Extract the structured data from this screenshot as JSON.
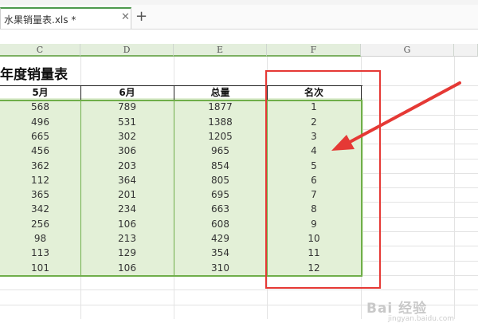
{
  "tabs": {
    "file_name": "水果销量表.xls *",
    "close_glyph": "✕",
    "new_tab_glyph": "+"
  },
  "columns": [
    "C",
    "D",
    "E",
    "F",
    "G"
  ],
  "sheet_title": "年度销量表",
  "table": {
    "headers": [
      "5月",
      "6月",
      "总量",
      "名次"
    ],
    "rows": [
      [
        "568",
        "789",
        "1877",
        "1"
      ],
      [
        "496",
        "531",
        "1388",
        "2"
      ],
      [
        "665",
        "302",
        "1205",
        "3"
      ],
      [
        "456",
        "306",
        "965",
        "4"
      ],
      [
        "362",
        "203",
        "854",
        "5"
      ],
      [
        "112",
        "364",
        "805",
        "6"
      ],
      [
        "365",
        "201",
        "695",
        "7"
      ],
      [
        "342",
        "234",
        "663",
        "8"
      ],
      [
        "256",
        "106",
        "608",
        "9"
      ],
      [
        "98",
        "213",
        "429",
        "10"
      ],
      [
        "113",
        "129",
        "354",
        "11"
      ],
      [
        "101",
        "106",
        "310",
        "12"
      ]
    ]
  },
  "colors": {
    "selection_fill": "#e3f0d7",
    "selection_border": "#6fae4a",
    "annotation": "#e53935"
  },
  "watermark": {
    "text": "Bai 经验",
    "sub": "jingyan.baidu.com"
  }
}
